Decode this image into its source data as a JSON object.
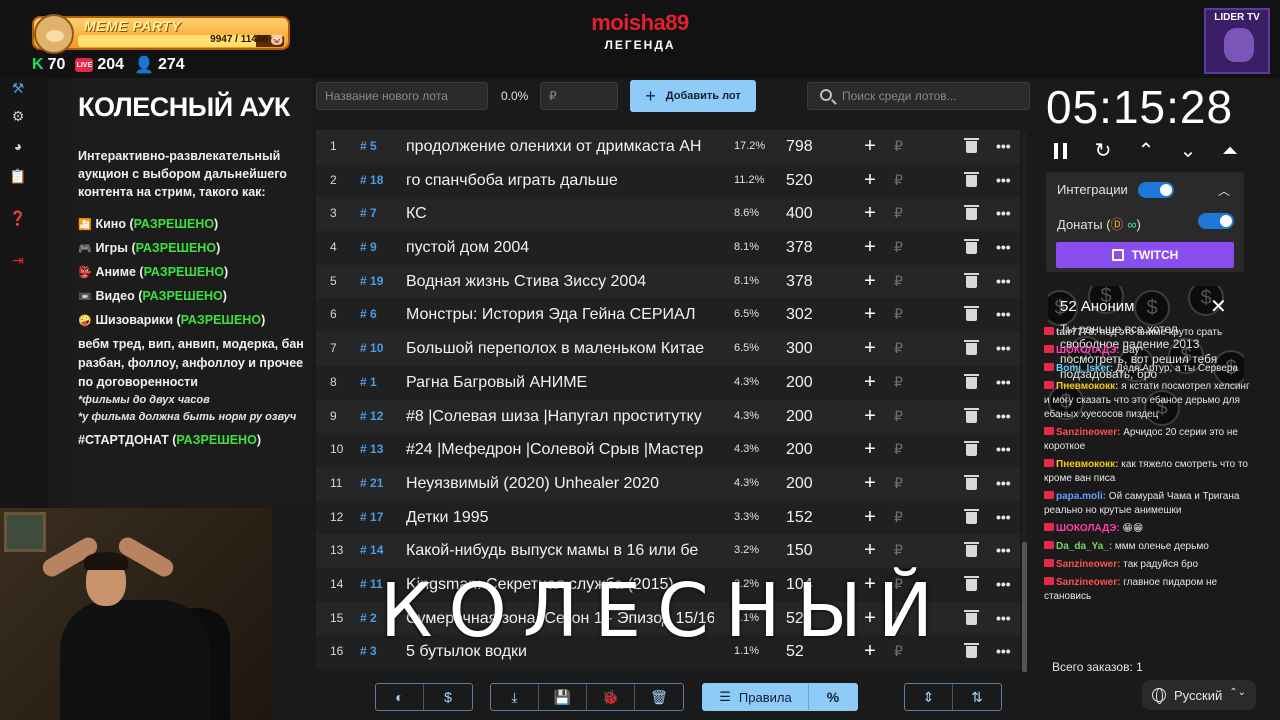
{
  "header": {
    "meme_title": "MEME PARTY",
    "meme_count": "9947 / 11488",
    "meme_progress": 0.866,
    "stats": [
      {
        "icon": "kick-icon",
        "value": "70"
      },
      {
        "icon": "live-icon",
        "value": "204"
      },
      {
        "icon": "user-icon",
        "value": "274"
      }
    ],
    "streamer_name": "moisha89",
    "streamer_sub": "ЛЕГЕНДА",
    "lider_label": "LIDER TV"
  },
  "desc": {
    "title": "КОЛЕСНЫЙ АУК",
    "intro": "Интерактивно-развлекательный аукцион с выбором дальнейшего контента на стрим, такого как:",
    "items": [
      {
        "label": "Кино",
        "status": "РАЗРЕШЕНО"
      },
      {
        "label": "Игры",
        "status": "РАЗРЕШЕНО"
      },
      {
        "label": "Аниме",
        "status": "РАЗРЕШЕНО"
      },
      {
        "label": "Видео",
        "status": "РАЗРЕШЕНО"
      },
      {
        "label": "Шизоварики",
        "status": "РАЗРЕШЕНО"
      }
    ],
    "rules": "вебм тред, вип, анвип, модерка, бан разбан, фоллоу, анфоллоу и прочее по договоренности",
    "note1": "*фильмы до двух часов",
    "note2": "*у фильма должна быть норм ру озвуч",
    "start_label": "#СТАРТДОНАТ",
    "start_status": "РАЗРЕШЕНО"
  },
  "toolbar": {
    "lot_placeholder": "Название нового лота",
    "pct": "0.0%",
    "rub_placeholder": "₽",
    "add_label": "Добавить лот",
    "search_placeholder": "Поиск среди лотов..."
  },
  "lots": [
    {
      "n": "1",
      "id": "5",
      "title": "продолжение оленихи от дримкаста АН",
      "pct": "17.2%",
      "amount": "798"
    },
    {
      "n": "2",
      "id": "18",
      "title": " го спанчбоба играть дальше",
      "pct": "11.2%",
      "amount": "520"
    },
    {
      "n": "3",
      "id": "7",
      "title": "КС",
      "pct": "8.6%",
      "amount": "400"
    },
    {
      "n": "4",
      "id": "9",
      "title": "пустой дом 2004",
      "pct": "8.1%",
      "amount": "378"
    },
    {
      "n": "5",
      "id": "19",
      "title": " Водная жизнь Стива Зиссу 2004",
      "pct": "8.1%",
      "amount": "378"
    },
    {
      "n": "6",
      "id": "6",
      "title": "Монстры: История Эда Гейна СЕРИАЛ",
      "pct": "6.5%",
      "amount": "302"
    },
    {
      "n": "7",
      "id": "10",
      "title": " Большой переполох в маленьком Китае",
      "pct": "6.5%",
      "amount": "300"
    },
    {
      "n": "8",
      "id": "1",
      "title": "Рагна Багровый АНИМЕ",
      "pct": "4.3%",
      "amount": "200"
    },
    {
      "n": "9",
      "id": "12",
      "title": " #8 |Солевая шиза |Напугал проститутку",
      "pct": "4.3%",
      "amount": "200"
    },
    {
      "n": "10",
      "id": "13",
      "title": " #24 |Мефедрон |Солевой Срыв |Мастер",
      "pct": "4.3%",
      "amount": "200"
    },
    {
      "n": "11",
      "id": "21",
      "title": " Неуязвимый (2020) Unhealer 2020",
      "pct": "4.3%",
      "amount": "200"
    },
    {
      "n": "12",
      "id": "17",
      "title": " Детки 1995",
      "pct": "3.3%",
      "amount": "152"
    },
    {
      "n": "13",
      "id": "14",
      "title": " Какой-нибудь выпуск мамы в 16 или бе",
      "pct": "3.2%",
      "amount": "150"
    },
    {
      "n": "14",
      "id": "11",
      "title": " Kingsman: Секретная служба (2015)",
      "pct": "2.2%",
      "amount": "104"
    },
    {
      "n": "15",
      "id": "2",
      "title": "Сумеречная зона. Сезон 1 - Эпизод 15/16",
      "pct": "1.1%",
      "amount": "52"
    },
    {
      "n": "16",
      "id": "3",
      "title": "5 бутылок водки",
      "pct": "1.1%",
      "amount": "52"
    }
  ],
  "overlay_word": "КОЛЕСНЫЙ",
  "bottom": {
    "rules_label": "Правила",
    "pct_symbol": "%"
  },
  "right": {
    "timer": "05:15:28",
    "integrations_label": "Интеграции",
    "donations_label": "Донаты (",
    "donations_suffix": ")",
    "twitch_label": "TWITCH",
    "donate_head": "52 Аноним",
    "donate_text": "Ты раньше все хотел свободное падение 2013 посмотреть, вот решил тебя подзадовать, бро",
    "chat": [
      {
        "user": "tair7778:",
        "color": "#c8c8c8",
        "text": " под это аниме круто срать"
      },
      {
        "user": "ШОКОЛАДЭ:",
        "color": "#ff3fb0",
        "text": " Вау"
      },
      {
        "user": "Bomj_Isker:",
        "color": "#5fd0ff",
        "text": " Дядя Артур, а ты Сервера"
      },
      {
        "user": "Пневмококк:",
        "color": "#f5c518",
        "text": " я кстати посмотрел хелсинг и могу сказать что это ебаное дерьмо для ебаных хуесосов пиздец"
      },
      {
        "user": "Sanzineower:",
        "color": "#ff5050",
        "text": " Арчидос 20 серии это не короткое"
      },
      {
        "user": "Пневмококк:",
        "color": "#f5c518",
        "text": " как тяжело смотреть что то кроме ван писа"
      },
      {
        "user": "papa.moli:",
        "color": "#5fa0ff",
        "text": " Ой самурай Чама и Тригана реально но крутые анимешки"
      },
      {
        "user": "ШОКОЛАДЭ:",
        "color": "#ff3fb0",
        "text": " 😁😁"
      },
      {
        "user": "Da_da_Ya_:",
        "color": "#7ad35a",
        "text": " ммм оленье дерьмо"
      },
      {
        "user": "Sanzineower:",
        "color": "#ff5050",
        "text": " так радуйся бро"
      },
      {
        "user": "Sanzineower:",
        "color": "#ff5050",
        "text": " главное пидаром не становись"
      }
    ],
    "total": "Всего заказов: 1",
    "lang": "Русский"
  },
  "colors": {
    "accent": "#8ecbf7",
    "ok": "#3ee03e",
    "brand": "#e5202e",
    "twitch": "#8a4ef0"
  }
}
